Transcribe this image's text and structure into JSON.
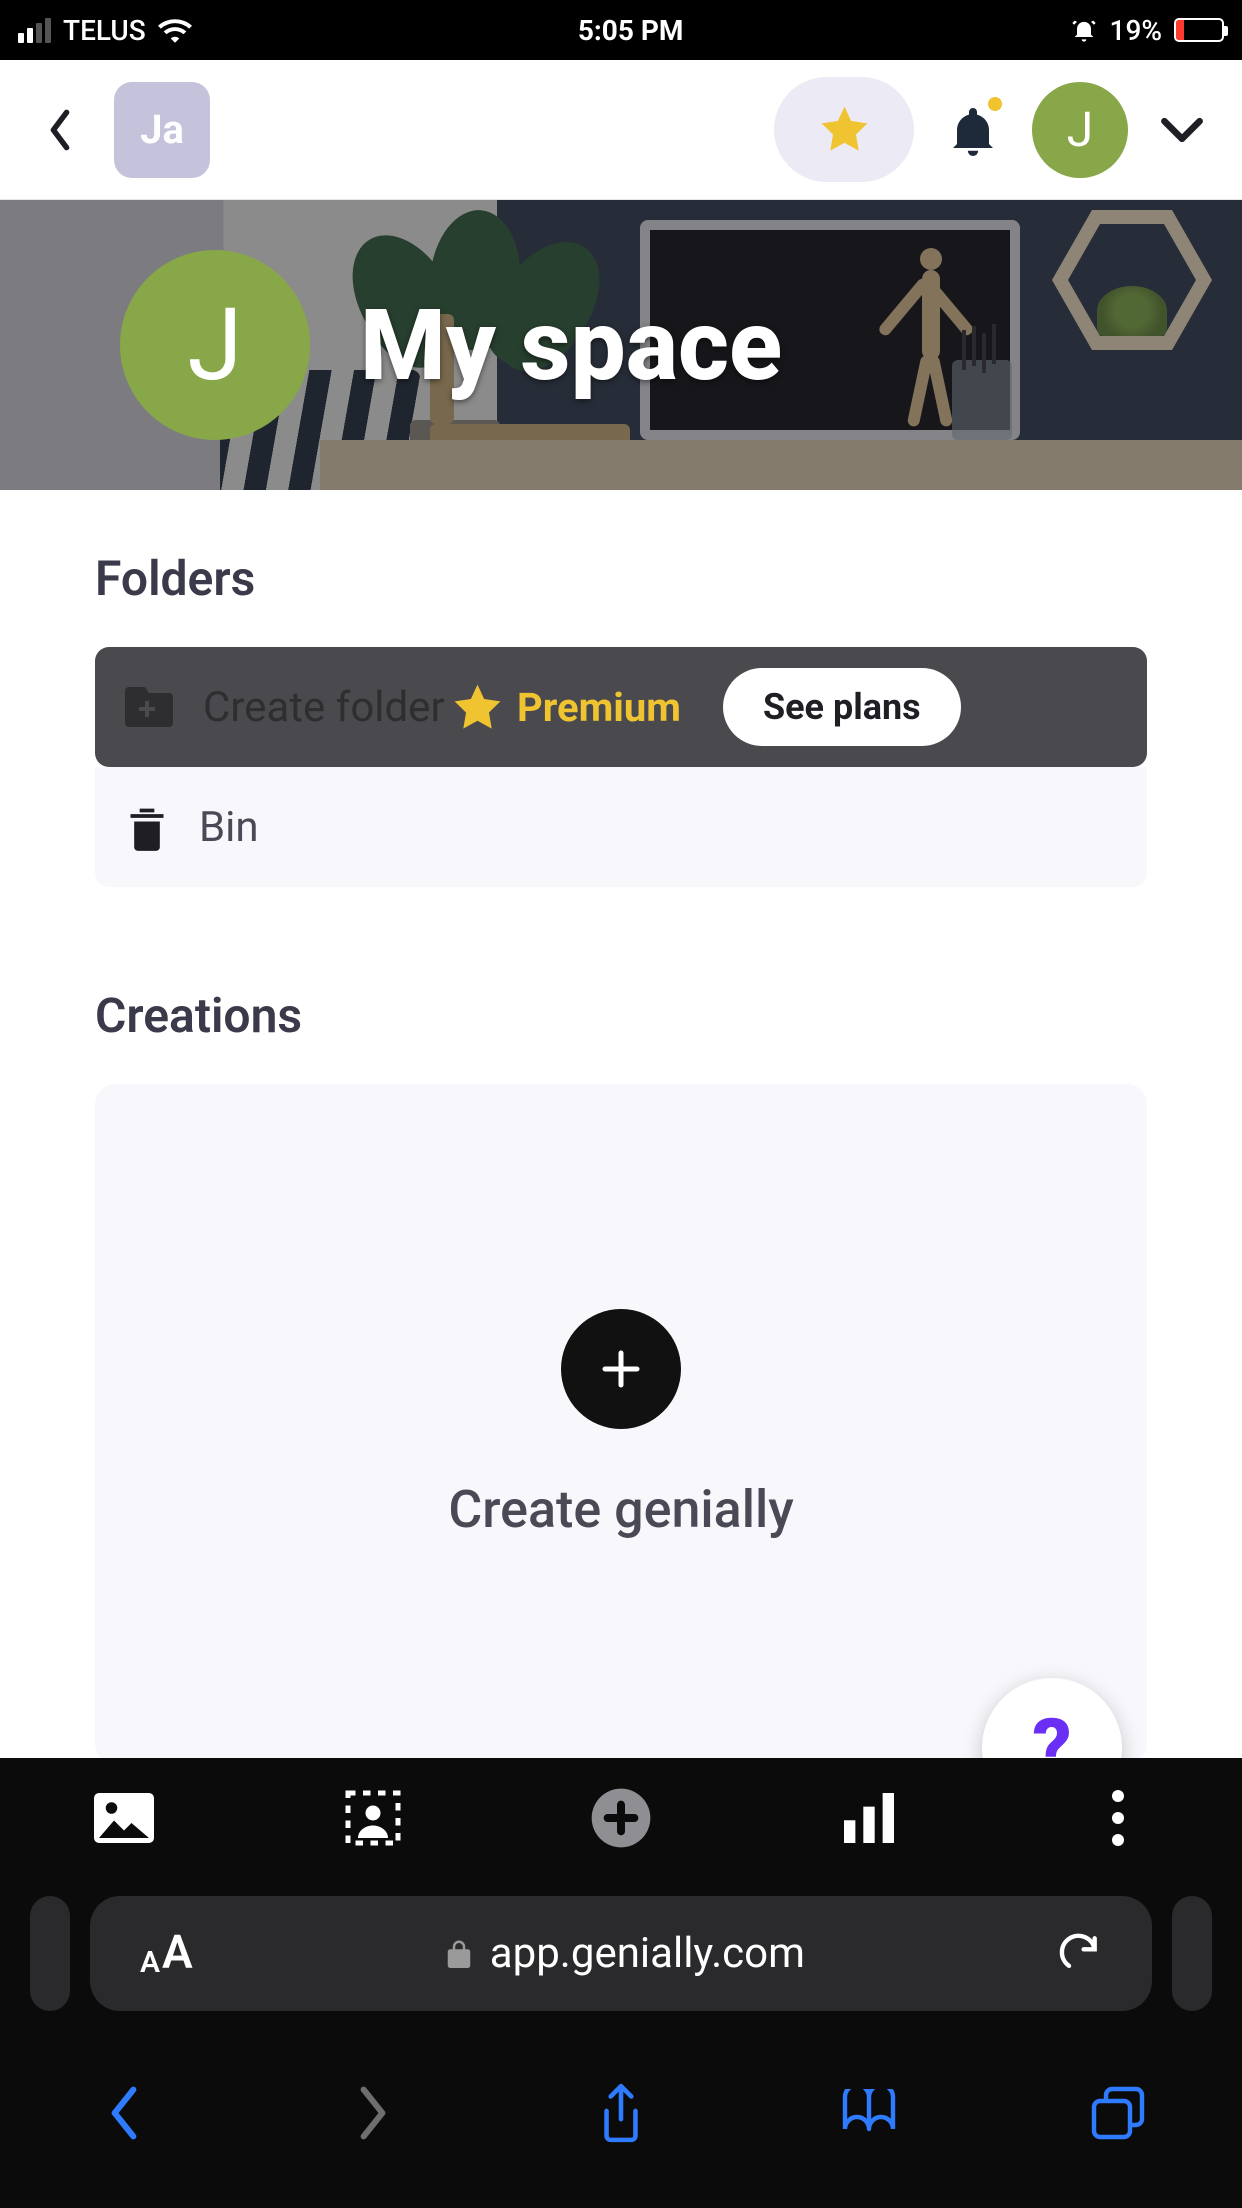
{
  "status_bar": {
    "carrier": "TELUS",
    "time": "5:05 PM",
    "battery_pct": "19%"
  },
  "app_nav": {
    "brand_initials": "Ja",
    "avatar_initial": "J"
  },
  "hero": {
    "avatar_initial": "J",
    "title": "My space"
  },
  "folders": {
    "section_title": "Folders",
    "create_folder_label": "Create folder",
    "bin_label": "Bin",
    "premium_label": "Premium",
    "see_plans_label": "See plans"
  },
  "creations": {
    "section_title": "Creations",
    "create_label": "Create genially"
  },
  "help_label": "?",
  "browser": {
    "host": "app.genially.com"
  }
}
